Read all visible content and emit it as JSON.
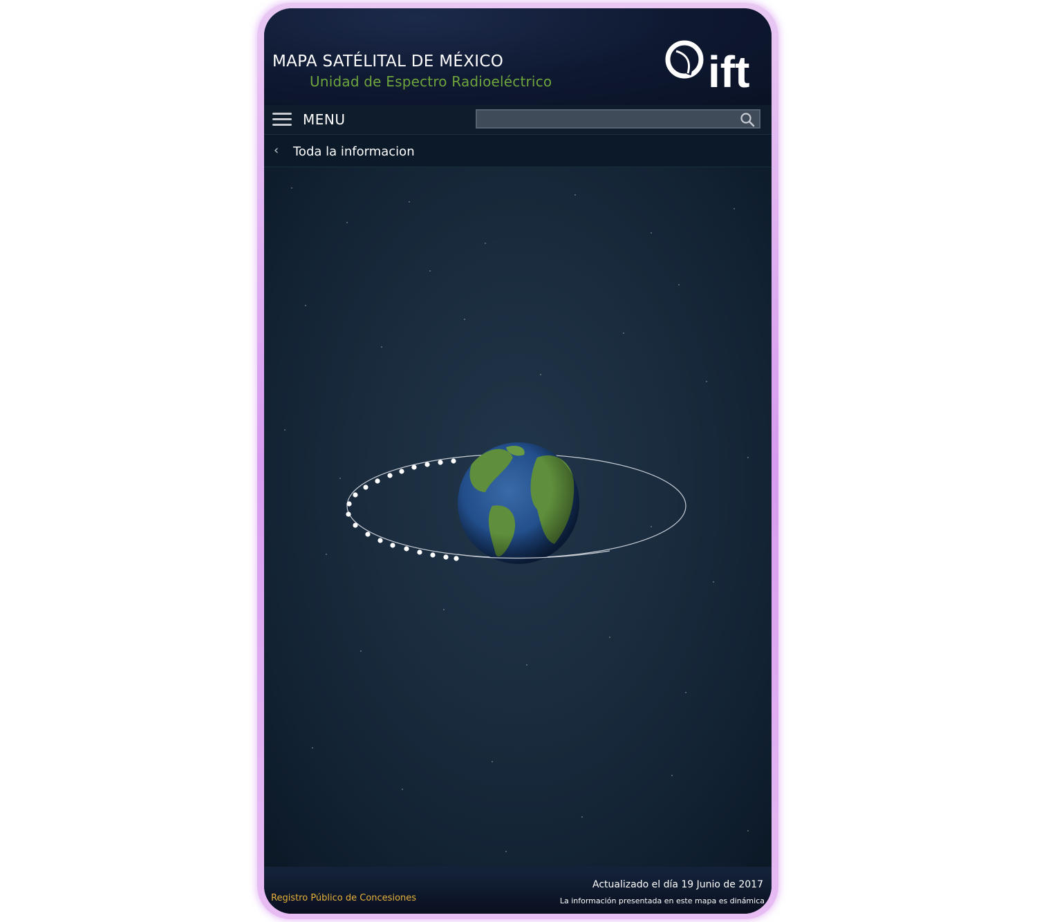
{
  "header": {
    "title": "MAPA SATÉLITAL DE MÉXICO",
    "subtitle": "Unidad de Espectro Radioeléctrico",
    "logo_text": "ift"
  },
  "menubar": {
    "menu_label": "MENU",
    "search_placeholder": "",
    "search_value": ""
  },
  "breadcrumb": {
    "label": "Toda la informacion"
  },
  "footer": {
    "registro_link": "Registro Público de Concesiones",
    "updated_prefix": "Actualizado",
    "updated_date": "el día 19  Junio de 2017",
    "dynamic_note": "La información presentada en este mapa es dinámica"
  },
  "colors": {
    "subtitle_green": "#6ea53d",
    "link_orange": "#e8b23a",
    "frame_glow": "#d79cef"
  }
}
